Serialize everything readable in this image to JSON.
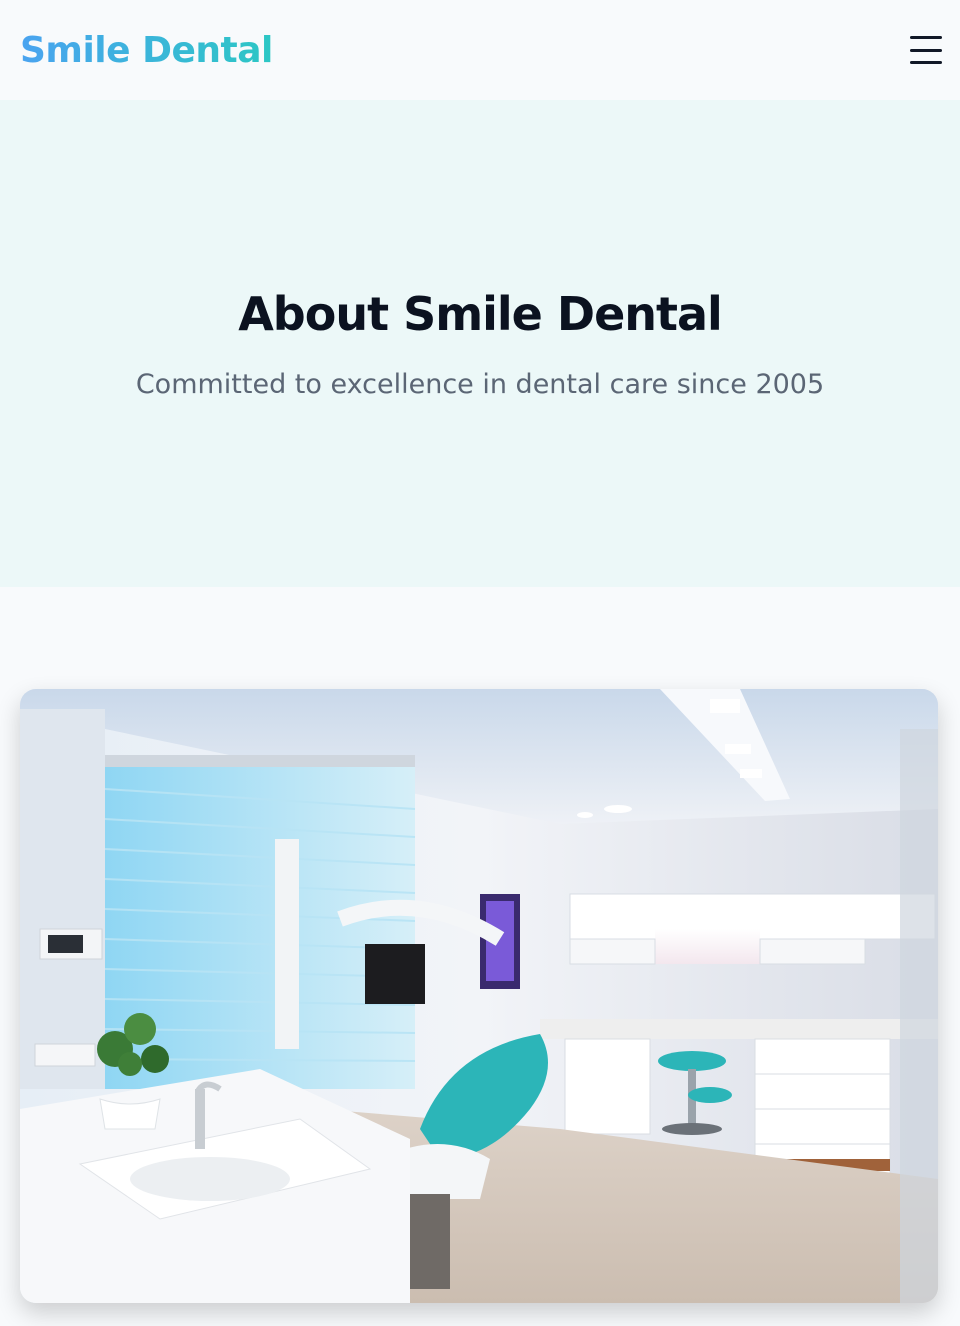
{
  "header": {
    "brand": "Smile Dental",
    "menu_icon": "hamburger-menu-icon"
  },
  "hero": {
    "title": "About Smile Dental",
    "subtitle": "Committed to excellence in dental care since 2005"
  },
  "about_image": {
    "description_icon": "dental-clinic-photo",
    "colors": {
      "accent": "#2cb5b8",
      "brand_start": "#4aa3f0",
      "brand_end": "#2cc7c4"
    }
  }
}
